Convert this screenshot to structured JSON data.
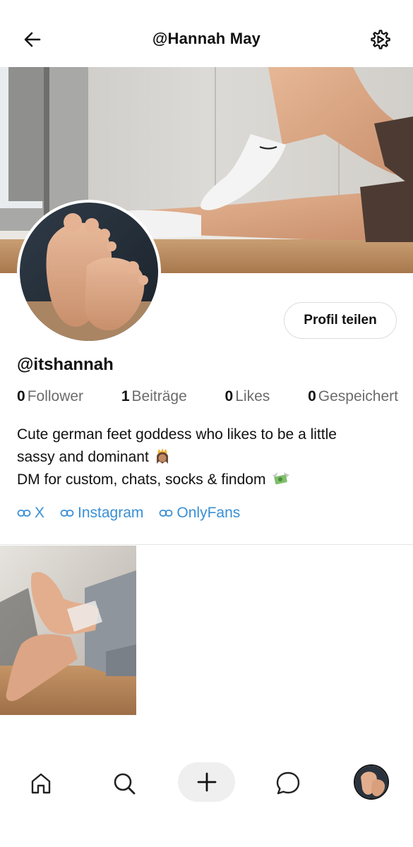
{
  "header": {
    "title": "@Hannah May",
    "back_icon": "arrow-left-icon",
    "settings_icon": "gear-icon"
  },
  "profile": {
    "share_label": "Profil teilen",
    "handle": "@itshannah",
    "stats": [
      {
        "num": "0",
        "label": "Follower"
      },
      {
        "num": "1",
        "label": "Beiträge"
      },
      {
        "num": "0",
        "label": "Likes"
      },
      {
        "num": "0",
        "label": "Gespeichert"
      }
    ],
    "bio": {
      "line1": "Cute german feet goddess who likes to be a little",
      "line2": "sassy and dominant",
      "line3": "DM for custom, chats, socks & findom"
    },
    "links": [
      {
        "label": "X"
      },
      {
        "label": "Instagram"
      },
      {
        "label": "OnlyFans"
      }
    ]
  },
  "nav": {
    "items": [
      "home-icon",
      "search-icon",
      "plus-icon",
      "chat-bubble-icon",
      "profile-avatar"
    ]
  },
  "colors": {
    "link": "#3a8fd4",
    "muted": "#6b6b6b",
    "text": "#111111"
  }
}
